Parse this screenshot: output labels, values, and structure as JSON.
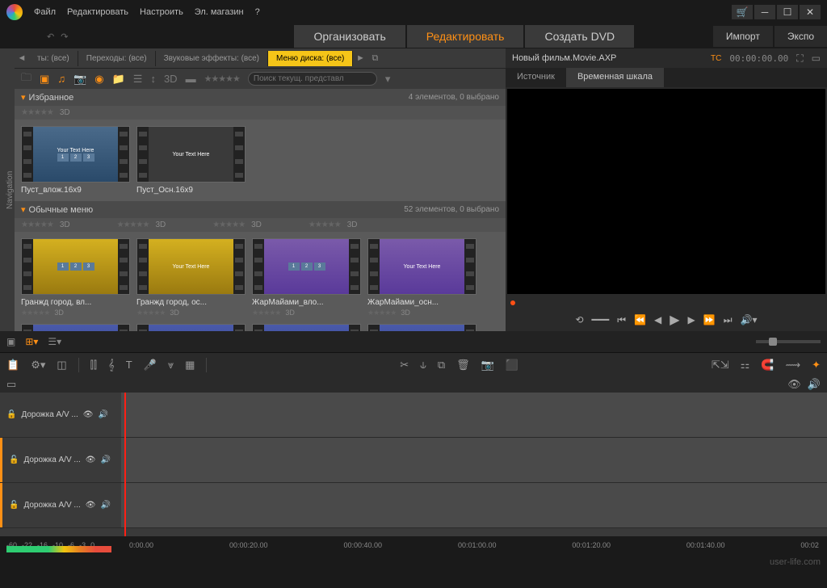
{
  "menu": {
    "file": "Файл",
    "edit": "Редактировать",
    "setup": "Настроить",
    "store": "Эл. магазин"
  },
  "mainTabs": {
    "organize": "Организовать",
    "edit": "Редактировать",
    "dvd": "Создать DVD"
  },
  "sideBtns": {
    "import": "Импорт",
    "export": "Экспо"
  },
  "libTabs": {
    "t1": "ты: (все)",
    "t2": "Переходы: (все)",
    "t3": "Звуковые эффекты: (все)",
    "t4": "Меню диска: (все)"
  },
  "search": {
    "ph": "Поиск текущ. представл"
  },
  "sections": {
    "fav": {
      "title": "Избранное",
      "count": "4 элементов, 0 выбрано",
      "badge": "3D"
    },
    "normal": {
      "title": "Обычные меню",
      "count": "52 элементов, 0 выбрано",
      "badge": "3D"
    }
  },
  "thumbs": {
    "f1": "Пуст_влож.16x9",
    "f2": "Пуст_Осн.16x9",
    "n1": "Гранжд город, вл...",
    "n2": "Гранжд город, ос...",
    "n3": "ЖарМайами_вло...",
    "n4": "ЖарМайами_осн...",
    "txt1": "Your Text Here",
    "txt2": "Your Text Here"
  },
  "nav": "Navigation",
  "preview": {
    "title": "Новый фильм.Movie.AXP",
    "tcLabel": "TC",
    "tc": "00:00:00.00",
    "tabSource": "Источник",
    "tabTimeline": "Временная шкала"
  },
  "tracks": {
    "t1": "Дорожка A/V ...",
    "t2": "Дорожка A/V ...",
    "t3": "Дорожка A/V ..."
  },
  "ruler": {
    "r0": "0:00.00",
    "r1": "00:00:20.00",
    "r2": "00:00:40.00",
    "r3": "00:01:00.00",
    "r4": "00:01:20.00",
    "r5": "00:01:40.00",
    "r6": "00:02"
  },
  "db": {
    "d1": "-60",
    "d2": "-22",
    "d3": "-16",
    "d4": "-10",
    "d5": "-6",
    "d6": "-3",
    "d7": "0"
  },
  "watermark": "user-life.com"
}
